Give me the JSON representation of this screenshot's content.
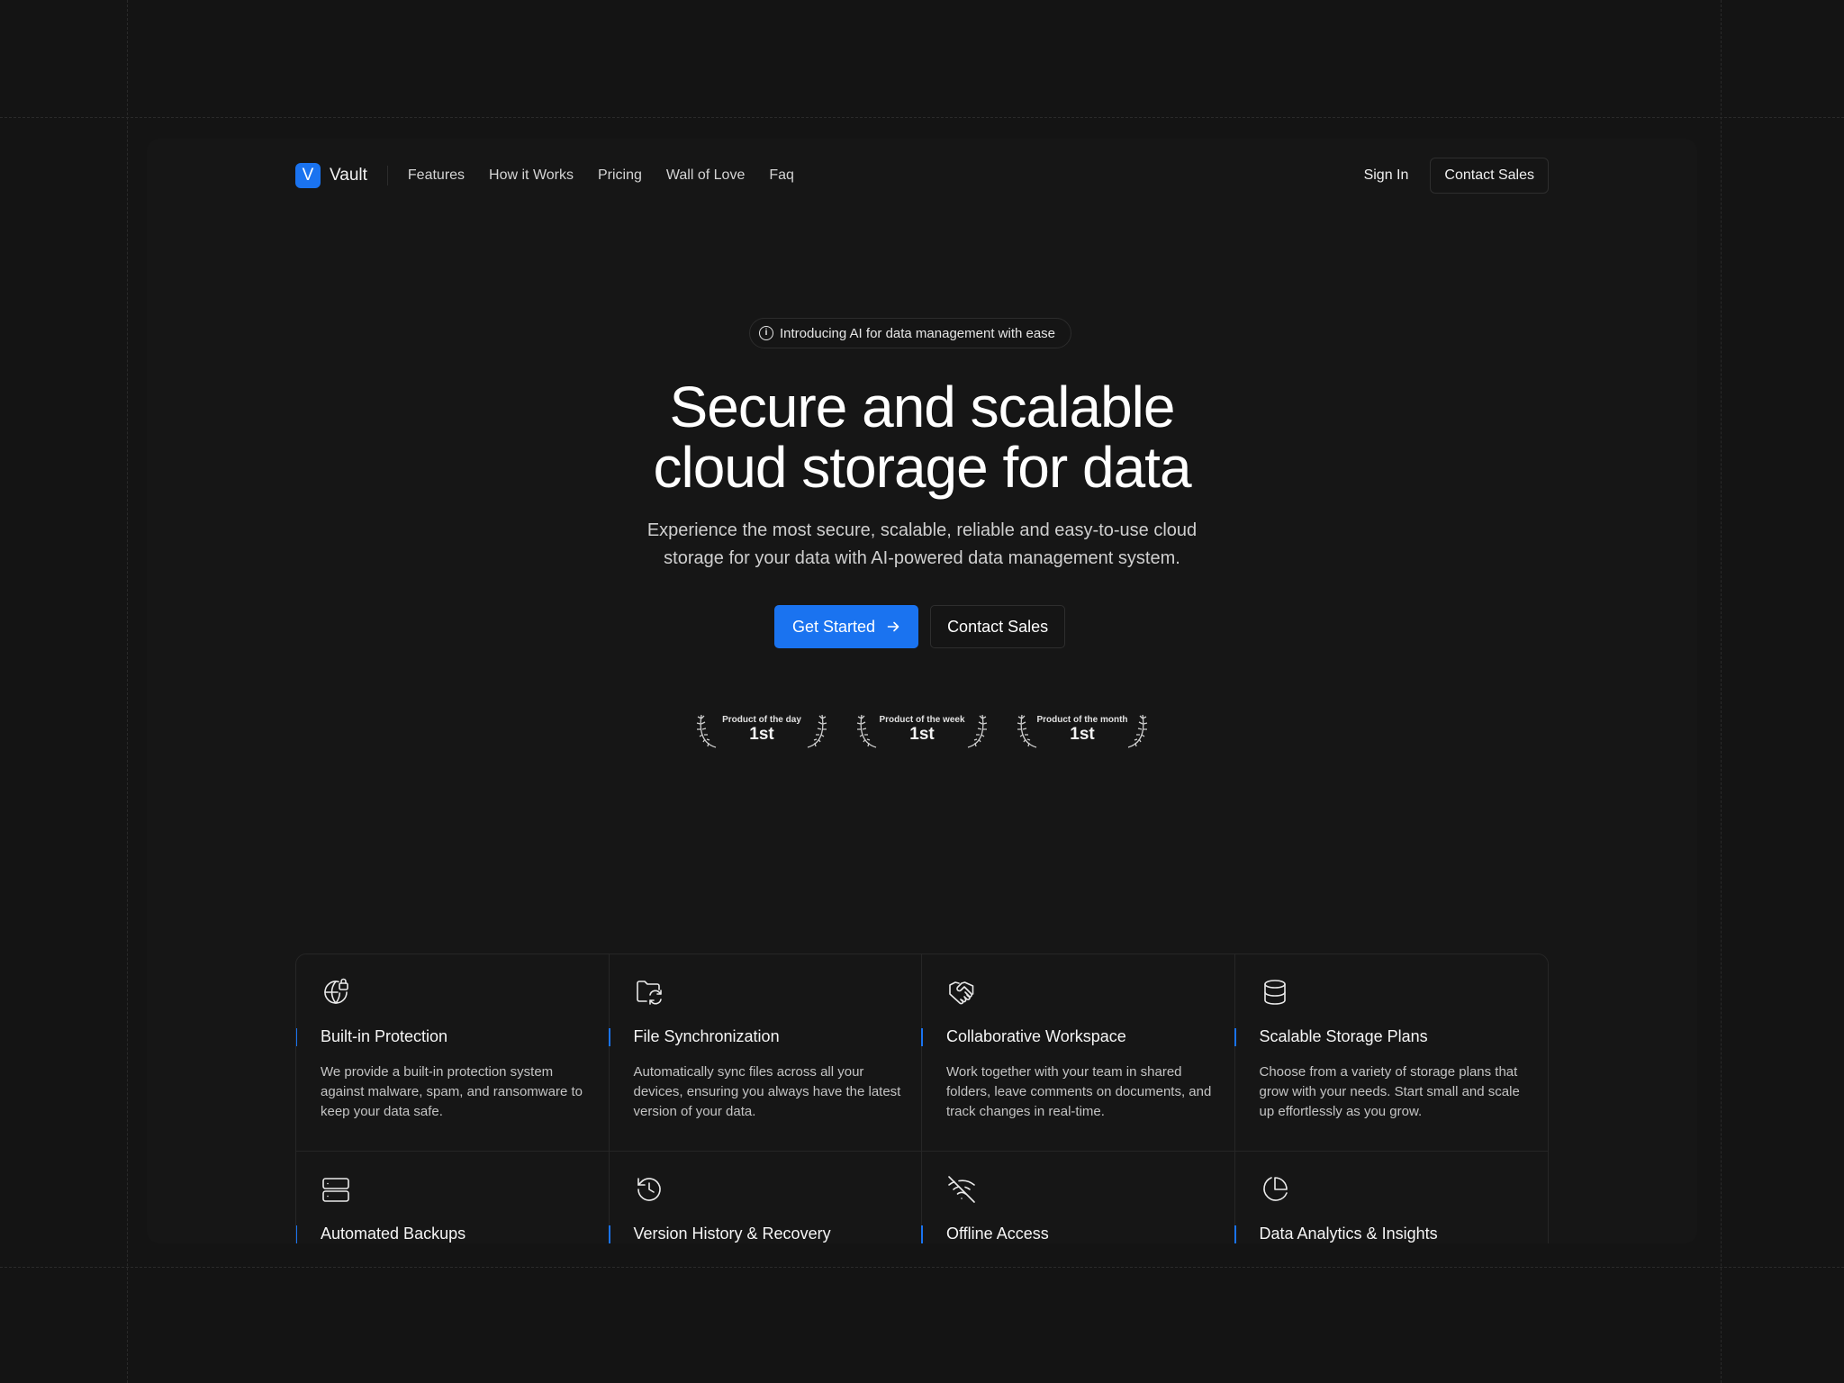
{
  "nav": {
    "logo_letter": "V",
    "brand": "Vault",
    "links": [
      "Features",
      "How it Works",
      "Pricing",
      "Wall of Love",
      "Faq"
    ],
    "sign_in": "Sign In",
    "contact_sales": "Contact Sales"
  },
  "hero": {
    "announcement": "Introducing AI for data management with ease",
    "title_line1": "Secure and scalable",
    "title_line2": "cloud storage for data",
    "subtitle_line1": "Experience the most secure, scalable, reliable and easy-to-use cloud",
    "subtitle_line2": "storage for your data with AI-powered data management system.",
    "primary_cta": "Get Started",
    "secondary_cta": "Contact Sales"
  },
  "awards": [
    {
      "label": "Product of the day",
      "rank": "1st"
    },
    {
      "label": "Product of the week",
      "rank": "1st"
    },
    {
      "label": "Product of the month",
      "rank": "1st"
    }
  ],
  "features": [
    {
      "icon": "globe-lock-icon",
      "title": "Built-in Protection",
      "description": "We provide a built-in protection system against malware, spam, and ransomware to keep your data safe."
    },
    {
      "icon": "folder-sync-icon",
      "title": "File Synchronization",
      "description": "Automatically sync files across all your devices, ensuring you always have the latest version of your data."
    },
    {
      "icon": "handshake-icon",
      "title": "Collaborative Workspace",
      "description": "Work together with your team in shared folders, leave comments on documents, and track changes in real-time."
    },
    {
      "icon": "database-icon",
      "title": "Scalable Storage Plans",
      "description": "Choose from a variety of storage plans that grow with your needs. Start small and scale up effortlessly as you grow."
    },
    {
      "icon": "server-icon",
      "title": "Automated Backups",
      "description": ""
    },
    {
      "icon": "history-icon",
      "title": "Version History & Recovery",
      "description": ""
    },
    {
      "icon": "wifi-off-icon",
      "title": "Offline Access",
      "description": ""
    },
    {
      "icon": "pie-chart-icon",
      "title": "Data Analytics & Insights",
      "description": ""
    }
  ],
  "colors": {
    "accent": "#1a73f0",
    "background": "#141414",
    "card": "#161616"
  }
}
